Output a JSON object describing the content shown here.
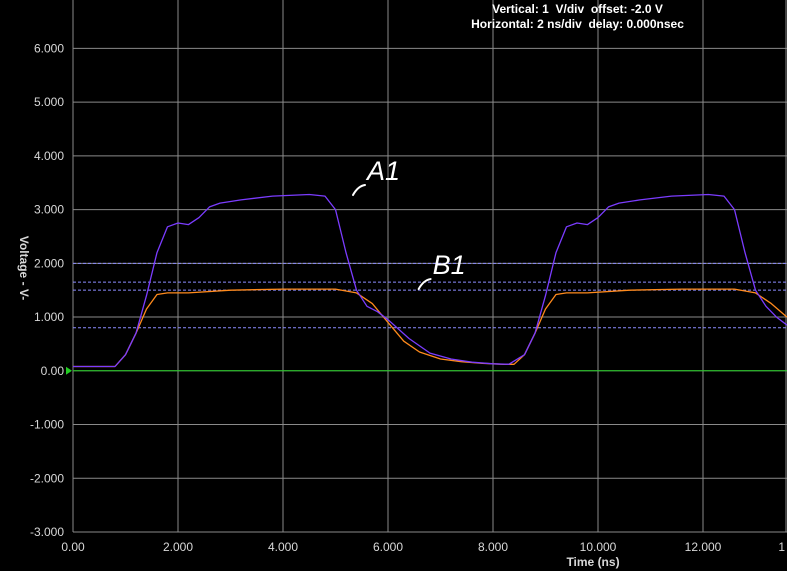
{
  "scope_header": {
    "vertical": "Vertical: 1  V/div  offset: -2.0 V",
    "horizontal": "Horizontal: 2 ns/div  delay: 0.000nsec"
  },
  "colors": {
    "background": "#000000",
    "grid": "#8a8a8a",
    "axis_text": "#d8d8d8",
    "trace_A1": "#7b3cff",
    "trace_B1": "#ff8a1c",
    "zero_line": "#22cc22",
    "threshold_lines": "#8c8cff",
    "annotation": "#ffffff"
  },
  "chart_data": {
    "type": "line",
    "xlabel": "Time  (ns)",
    "ylabel": "Voltage  - V-",
    "xlim": [
      0,
      13.6
    ],
    "ylim": [
      -3.0,
      6.9
    ],
    "x_ticks": [
      "0.00",
      "2.000",
      "4.000",
      "6.000",
      "8.000",
      "10.000",
      "12.000",
      "1"
    ],
    "y_ticks": [
      "-3.000",
      "-2.000",
      "-1.000",
      "0.00",
      "1.000",
      "2.000",
      "3.000",
      "4.000",
      "5.000",
      "6.000"
    ],
    "grid": true,
    "zero_line": 0.0,
    "threshold_lines": [
      2.0,
      1.65,
      1.5,
      0.8
    ],
    "annotations": [
      {
        "text": "A1",
        "x": 5.6,
        "y": 3.55
      },
      {
        "text": "B1",
        "x": 6.85,
        "y": 1.8
      }
    ],
    "series": [
      {
        "name": "A1",
        "x": [
          0,
          0.8,
          1.0,
          1.2,
          1.4,
          1.6,
          1.8,
          2.0,
          2.2,
          2.4,
          2.6,
          2.8,
          3.2,
          3.8,
          4.5,
          4.8,
          5.0,
          5.2,
          5.4,
          5.6,
          5.8,
          6.0,
          6.4,
          6.8,
          7.2,
          7.6,
          8.0,
          8.3,
          8.6,
          8.8,
          9.0,
          9.2,
          9.4,
          9.6,
          9.8,
          10.0,
          10.2,
          10.4,
          10.8,
          11.4,
          12.1,
          12.4,
          12.6,
          12.8,
          13.0,
          13.2,
          13.4,
          13.6
        ],
        "y": [
          0.08,
          0.08,
          0.3,
          0.7,
          1.4,
          2.2,
          2.68,
          2.75,
          2.72,
          2.85,
          3.05,
          3.12,
          3.18,
          3.25,
          3.28,
          3.25,
          3.0,
          2.2,
          1.5,
          1.2,
          1.1,
          0.95,
          0.6,
          0.33,
          0.22,
          0.16,
          0.13,
          0.12,
          0.3,
          0.7,
          1.4,
          2.2,
          2.68,
          2.75,
          2.72,
          2.85,
          3.05,
          3.12,
          3.18,
          3.25,
          3.28,
          3.25,
          3.0,
          2.2,
          1.5,
          1.2,
          1.0,
          0.85
        ]
      },
      {
        "name": "B1",
        "x": [
          0,
          0.8,
          1.0,
          1.2,
          1.4,
          1.6,
          1.8,
          2.2,
          3.0,
          4.0,
          5.0,
          5.4,
          5.7,
          6.0,
          6.3,
          6.6,
          7.0,
          7.4,
          7.8,
          8.2,
          8.4,
          8.6,
          8.8,
          9.0,
          9.2,
          9.4,
          9.8,
          10.6,
          11.6,
          12.6,
          13.0,
          13.3,
          13.6
        ],
        "y": [
          0.08,
          0.08,
          0.3,
          0.7,
          1.15,
          1.42,
          1.45,
          1.45,
          1.5,
          1.52,
          1.52,
          1.45,
          1.25,
          0.9,
          0.55,
          0.35,
          0.22,
          0.17,
          0.14,
          0.12,
          0.12,
          0.3,
          0.7,
          1.15,
          1.42,
          1.45,
          1.45,
          1.5,
          1.52,
          1.52,
          1.45,
          1.25,
          1.0
        ]
      }
    ]
  }
}
